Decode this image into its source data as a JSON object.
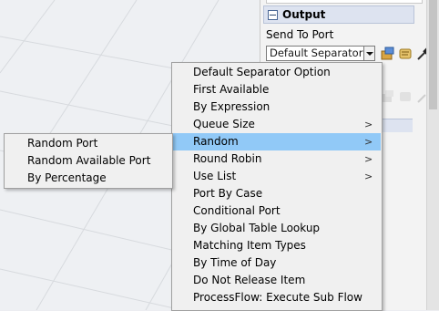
{
  "panel": {
    "section_title": "Output",
    "send_to_port_label": "Send To Port",
    "send_to_port_value": "Default Separator Opt"
  },
  "main_menu": [
    {
      "label": "Default Separator Option",
      "submenu": false
    },
    {
      "label": "First Available",
      "submenu": false
    },
    {
      "label": "By Expression",
      "submenu": false
    },
    {
      "label": "Queue Size",
      "submenu": true
    },
    {
      "label": "Random",
      "submenu": true,
      "highlighted": true
    },
    {
      "label": "Round Robin",
      "submenu": true
    },
    {
      "label": "Use List",
      "submenu": true
    },
    {
      "label": "Port By Case",
      "submenu": false
    },
    {
      "label": "Conditional Port",
      "submenu": false
    },
    {
      "label": "By Global Table Lookup",
      "submenu": false
    },
    {
      "label": "Matching Item Types",
      "submenu": false
    },
    {
      "label": "By Time of Day",
      "submenu": false
    },
    {
      "label": "Do Not Release Item",
      "submenu": false
    },
    {
      "label": "ProcessFlow: Execute Sub Flow",
      "submenu": false
    }
  ],
  "random_submenu": [
    {
      "label": "Random Port"
    },
    {
      "label": "Random Available Port"
    },
    {
      "label": "By Percentage"
    }
  ],
  "arrow_glyph": ">",
  "colors": {
    "highlight": "#91c9f7",
    "menu_bg": "#f0f0f0",
    "section_header": "#dde3f0"
  }
}
